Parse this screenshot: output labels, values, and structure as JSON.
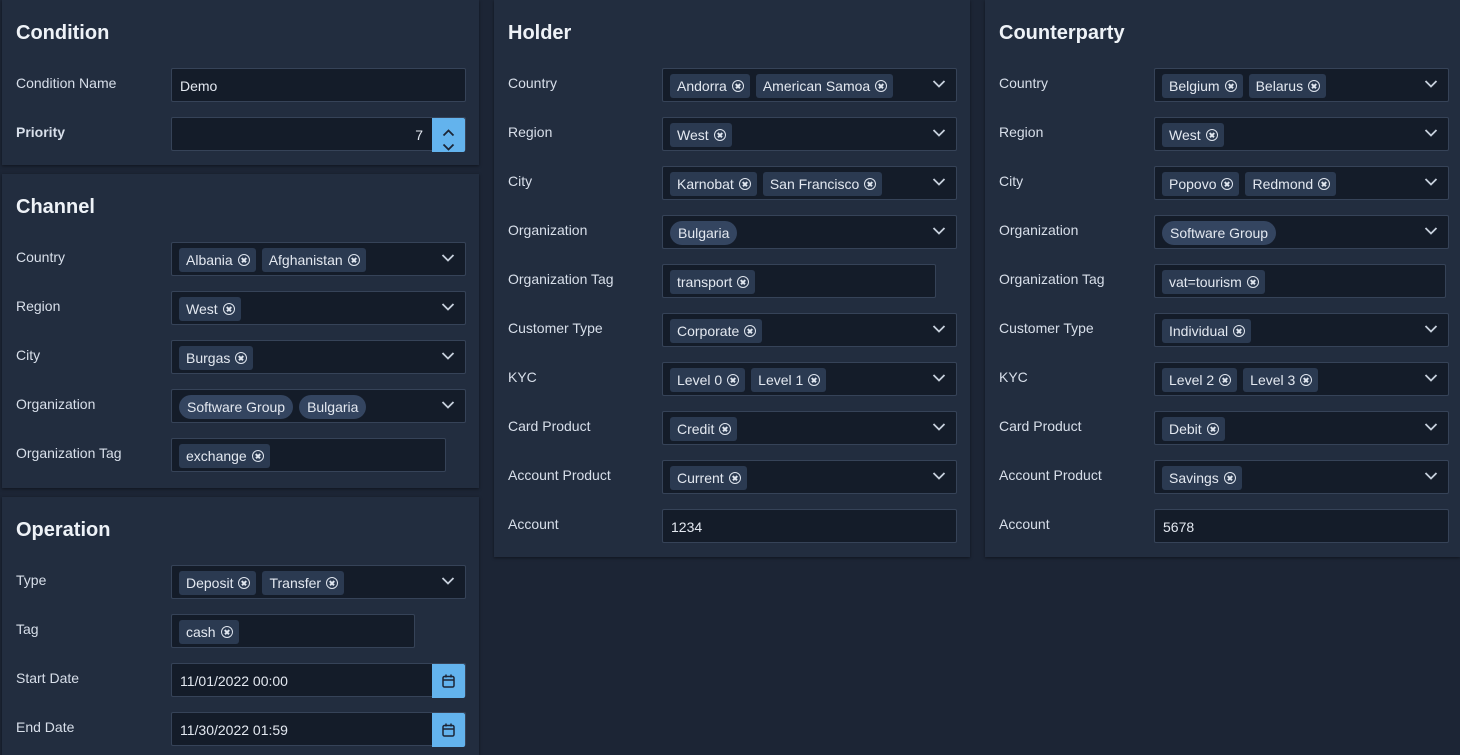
{
  "condition": {
    "title": "Condition",
    "name_label": "Condition Name",
    "name_value": "Demo",
    "priority_label": "Priority",
    "priority_value": "7"
  },
  "channel": {
    "title": "Channel",
    "rows": [
      {
        "label": "Country",
        "chips": [
          "Albania",
          "Afghanistan"
        ]
      },
      {
        "label": "Region",
        "chips": [
          "West"
        ]
      },
      {
        "label": "City",
        "chips": [
          "Burgas"
        ]
      },
      {
        "label": "Organization",
        "pills": [
          "Software Group",
          "Bulgaria"
        ]
      },
      {
        "label": "Organization Tag",
        "chips": [
          "exchange"
        ]
      }
    ]
  },
  "operation": {
    "title": "Operation",
    "type_label": "Type",
    "type_chips": [
      "Deposit",
      "Transfer"
    ],
    "tag_label": "Tag",
    "tag_chips": [
      "cash"
    ],
    "start_label": "Start Date",
    "start_value": "11/01/2022 00:00",
    "end_label": "End Date",
    "end_value": "11/30/2022 01:59"
  },
  "holder": {
    "title": "Holder",
    "rows": [
      {
        "label": "Country",
        "chips": [
          "Andorra",
          "American Samoa"
        ]
      },
      {
        "label": "Region",
        "chips": [
          "West"
        ]
      },
      {
        "label": "City",
        "chips": [
          "Karnobat",
          "San Francisco"
        ]
      },
      {
        "label": "Organization",
        "pills": [
          "Bulgaria"
        ]
      },
      {
        "label": "Organization Tag",
        "chips": [
          "transport"
        ]
      },
      {
        "label": "Customer Type",
        "chips": [
          "Corporate"
        ]
      },
      {
        "label": "KYC",
        "chips": [
          "Level 0",
          "Level 1"
        ]
      },
      {
        "label": "Card Product",
        "chips": [
          "Credit"
        ]
      },
      {
        "label": "Account Product",
        "chips": [
          "Current"
        ]
      },
      {
        "label": "Account",
        "value": "1234"
      }
    ]
  },
  "counterparty": {
    "title": "Counterparty",
    "rows": [
      {
        "label": "Country",
        "chips": [
          "Belgium",
          "Belarus"
        ]
      },
      {
        "label": "Region",
        "chips": [
          "West"
        ]
      },
      {
        "label": "City",
        "chips": [
          "Popovo",
          "Redmond"
        ]
      },
      {
        "label": "Organization",
        "pills": [
          "Software Group"
        ]
      },
      {
        "label": "Organization Tag",
        "chips": [
          "vat=tourism"
        ]
      },
      {
        "label": "Customer Type",
        "chips": [
          "Individual"
        ]
      },
      {
        "label": "KYC",
        "chips": [
          "Level 2",
          "Level 3"
        ]
      },
      {
        "label": "Card Product",
        "chips": [
          "Debit"
        ]
      },
      {
        "label": "Account Product",
        "chips": [
          "Savings"
        ]
      },
      {
        "label": "Account",
        "value": "5678"
      }
    ]
  },
  "colors": {
    "background": "#1c2535",
    "panel": "#222d3f",
    "field": "#141c29",
    "chip": "#2b3a51",
    "accent": "#63b3ed"
  },
  "icons": {
    "remove": "remove-chip-icon",
    "dropdown": "chevron-down-icon",
    "calendar": "calendar-icon",
    "spin_up": "chevron-up-icon",
    "spin_down": "chevron-down-icon"
  }
}
